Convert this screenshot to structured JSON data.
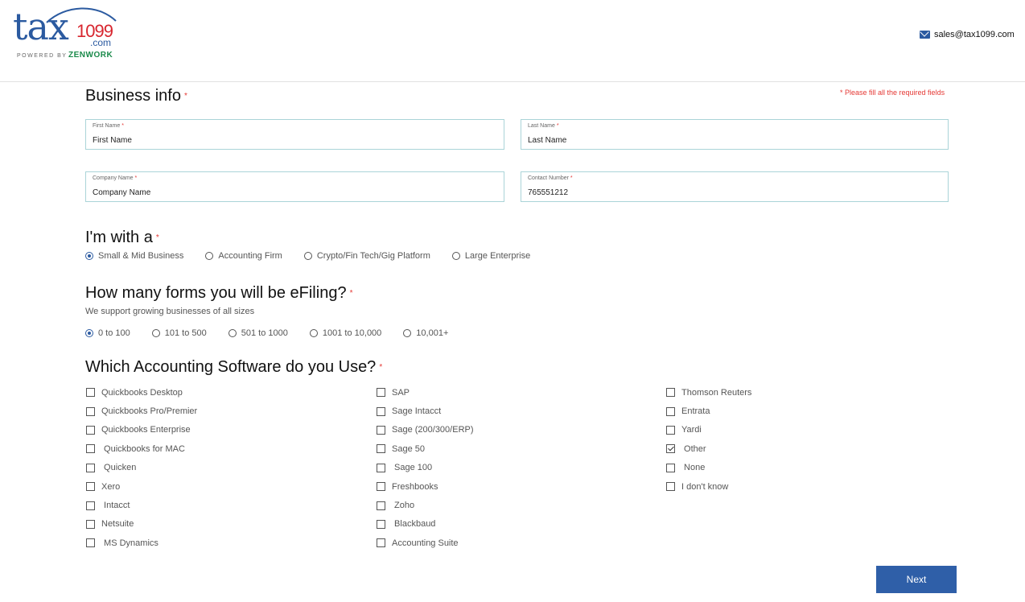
{
  "header": {
    "logo": {
      "main": "tax",
      "num": "1099",
      "dotcom": ".com",
      "powered": "POWERED BY",
      "brand": "ZENWORK"
    },
    "email": "sales@tax1099.com"
  },
  "business": {
    "title": "Business info",
    "required_mark": "*",
    "note": "* Please fill all the required fields",
    "fields": [
      {
        "label": "First Name",
        "value": "First Name"
      },
      {
        "label": "Last Name",
        "value": "Last Name"
      },
      {
        "label": "Company Name",
        "value": "Company Name"
      },
      {
        "label": "Contact Number",
        "value": "765551212"
      }
    ]
  },
  "with": {
    "title": "I'm with a",
    "options": [
      "Small & Mid Business",
      "Accounting Firm",
      "Crypto/Fin Tech/Gig Platform",
      "Large Enterprise"
    ],
    "selected": "Small & Mid Business"
  },
  "forms": {
    "title": "How many forms you will be eFiling?",
    "subtitle": "We support growing businesses of all sizes",
    "options": [
      "0 to 100",
      "101 to 500",
      "501 to 1000",
      "1001 to 10,000",
      "10,001+"
    ],
    "selected": "0 to 100"
  },
  "software": {
    "title": "Which Accounting Software do you Use?",
    "col1": [
      "Quickbooks Desktop",
      "Quickbooks Pro/Premier",
      "Quickbooks Enterprise",
      " Quickbooks for MAC",
      " Quicken",
      "Xero",
      " Intacct",
      "Netsuite",
      " MS Dynamics"
    ],
    "col2": [
      "SAP",
      "Sage Intacct",
      "Sage (200/300/ERP)",
      "Sage 50",
      " Sage 100",
      "Freshbooks",
      " Zoho",
      " Blackbaud",
      "Accounting Suite"
    ],
    "col3": [
      "Thomson Reuters",
      "Entrata",
      "Yardi",
      " Other",
      " None",
      "I don't know"
    ],
    "checked": [
      "col3:3"
    ]
  },
  "next_label": "Next"
}
